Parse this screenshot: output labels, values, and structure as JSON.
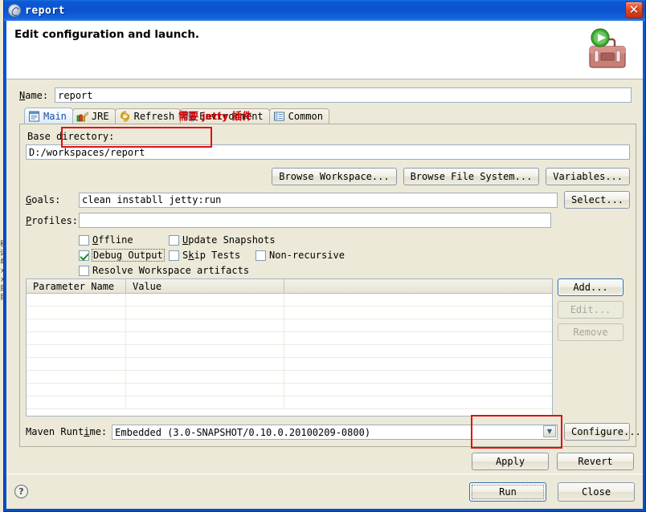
{
  "window": {
    "title": "report",
    "close_label": "✕",
    "icon": "maven-icon"
  },
  "header": {
    "title": "Edit configuration and launch.",
    "icon": "toolbox-run-icon"
  },
  "name_field": {
    "label": "Name:",
    "value": "report"
  },
  "tabs": [
    {
      "label": "Main",
      "icon": "main-document-icon",
      "active": true
    },
    {
      "label": "JRE",
      "icon": "jre-books-icon",
      "active": false
    },
    {
      "label": "Refresh",
      "icon": "refresh-arrows-icon",
      "active": false
    },
    {
      "label": "Environment",
      "icon": "environment-icon",
      "active": false
    },
    {
      "label": "Common",
      "icon": "common-list-icon",
      "active": false
    }
  ],
  "main_tab": {
    "base_directory": {
      "label": "Base directory:",
      "value": "D:/workspaces/report"
    },
    "browse_workspace_label": "Browse Workspace...",
    "browse_filesystem_label": "Browse File System...",
    "variables_label": "Variables...",
    "goals": {
      "label": "Goals:",
      "value": "clean instabll jetty:run"
    },
    "select_label": "Select...",
    "profiles": {
      "label": "Profiles:",
      "value": ""
    },
    "checkboxes": [
      {
        "label": "Offline",
        "checked": false,
        "focused": false
      },
      {
        "label": "Update Snapshots",
        "checked": false,
        "focused": false
      },
      {
        "label": "Debug Output",
        "checked": true,
        "focused": true
      },
      {
        "label": "Skip Tests",
        "checked": false,
        "focused": false
      },
      {
        "label": "Non-recursive",
        "checked": false,
        "focused": false
      },
      {
        "label": "Resolve Workspace artifacts",
        "checked": false,
        "focused": false
      }
    ],
    "parameter_table": {
      "columns": [
        "Parameter Name",
        "Value",
        ""
      ],
      "rows": [],
      "empty_row_count": 9
    },
    "table_buttons": [
      {
        "label": "Add...",
        "enabled": true
      },
      {
        "label": "Edit...",
        "enabled": false
      },
      {
        "label": "Remove",
        "enabled": false
      }
    ],
    "maven_runtime": {
      "label": "Maven Runtime:",
      "value": "Embedded (3.0-SNAPSHOT/0.10.0.20100209-0800)",
      "configure_label": "Configure..."
    }
  },
  "footer": {
    "apply_label": "Apply",
    "revert_label": "Revert",
    "run_label": "Run",
    "close_label": "Close",
    "help_label": "?"
  },
  "annotations": {
    "jetty_note": "需要 jetty 插件"
  },
  "colors": {
    "titlebar_blue": "#0b52cf",
    "dialog_bg": "#ece9d8",
    "annotation_red": "#cc0000",
    "active_tab_text": "#1a4f9c"
  }
}
